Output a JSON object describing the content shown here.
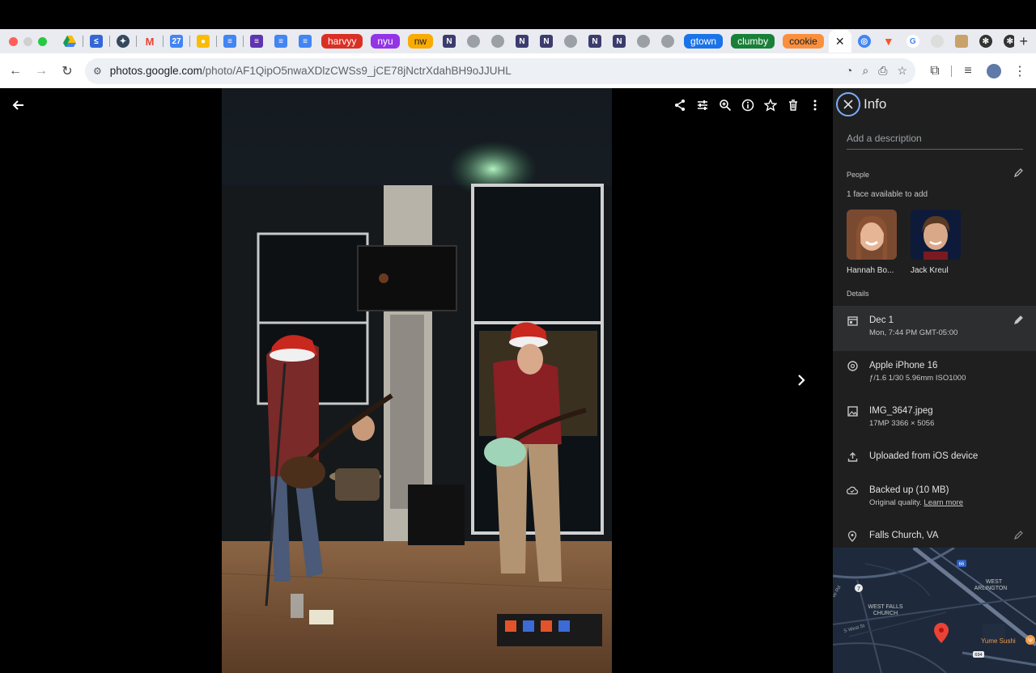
{
  "browser": {
    "tab_groups": [
      {
        "label": "harvyy",
        "color": "#d93025"
      },
      {
        "label": "nyu",
        "color": "#9334e6"
      },
      {
        "label": "nw",
        "color": "#f9ab00"
      },
      {
        "label": "gtown",
        "color": "#1a73e8"
      },
      {
        "label": "clumby",
        "color": "#188038"
      },
      {
        "label": "cookie",
        "color": "#fa903e"
      }
    ],
    "active_tab_close": "✕",
    "new_tab": "+",
    "url_host": "photos.google.com",
    "url_path": "/photo/AF1QipO5nwaXDlzCWSs9_jCE78jNctrXdahBH9oJJUHL"
  },
  "panel": {
    "title": "Info",
    "description_placeholder": "Add a description",
    "people_label": "People",
    "faces_note": "1 face available to add",
    "people": [
      {
        "name": "Hannah Bo..."
      },
      {
        "name": "Jack Kreul"
      }
    ],
    "details_label": "Details",
    "date": {
      "main": "Dec 1",
      "sub": "Mon, 7:44 PM   GMT-05:00"
    },
    "camera": {
      "main": "Apple iPhone 16",
      "sub": "ƒ/1.6   1/30   5.96mm   ISO1000"
    },
    "file": {
      "main": "IMG_3647.jpeg",
      "sub": "17MP   3366 × 5056"
    },
    "upload": {
      "main": "Uploaded from iOS device"
    },
    "backup": {
      "main": "Backed up (10 MB)",
      "sub_prefix": "Original quality. ",
      "link": "Learn more"
    },
    "location": {
      "main": "Falls Church, VA"
    },
    "map_labels": {
      "west_arlington_1": "WEST",
      "west_arlington_2": "ARLINGTON",
      "west_falls_1": "WEST FALLS",
      "west_falls_2": "CHURCH",
      "poi": "Yume Sushi",
      "street1": "S West St",
      "street2": "ve Rd",
      "shield1": "7",
      "shield2": "66",
      "shield3": "694"
    }
  }
}
